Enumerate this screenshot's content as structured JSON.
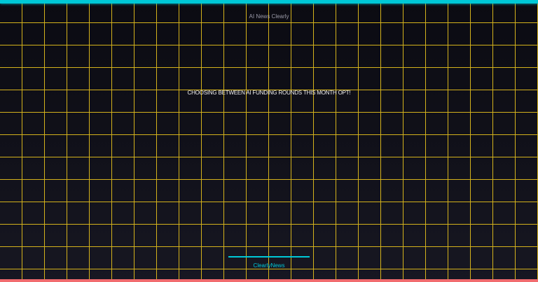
{
  "header": {
    "title": "AI News Clearly"
  },
  "main": {
    "headline": "CHOOSING BETWEEN AI FUNDING ROUNDS THIS MONTH OPT!"
  },
  "footer": {
    "brand": "ClearlyNews"
  },
  "colors": {
    "top_accent": "#00c8d7",
    "bottom_accent": "#f06b6e",
    "grid": "#d4b21c",
    "background": "#0d0d14",
    "footer_text": "#00c8d7"
  }
}
